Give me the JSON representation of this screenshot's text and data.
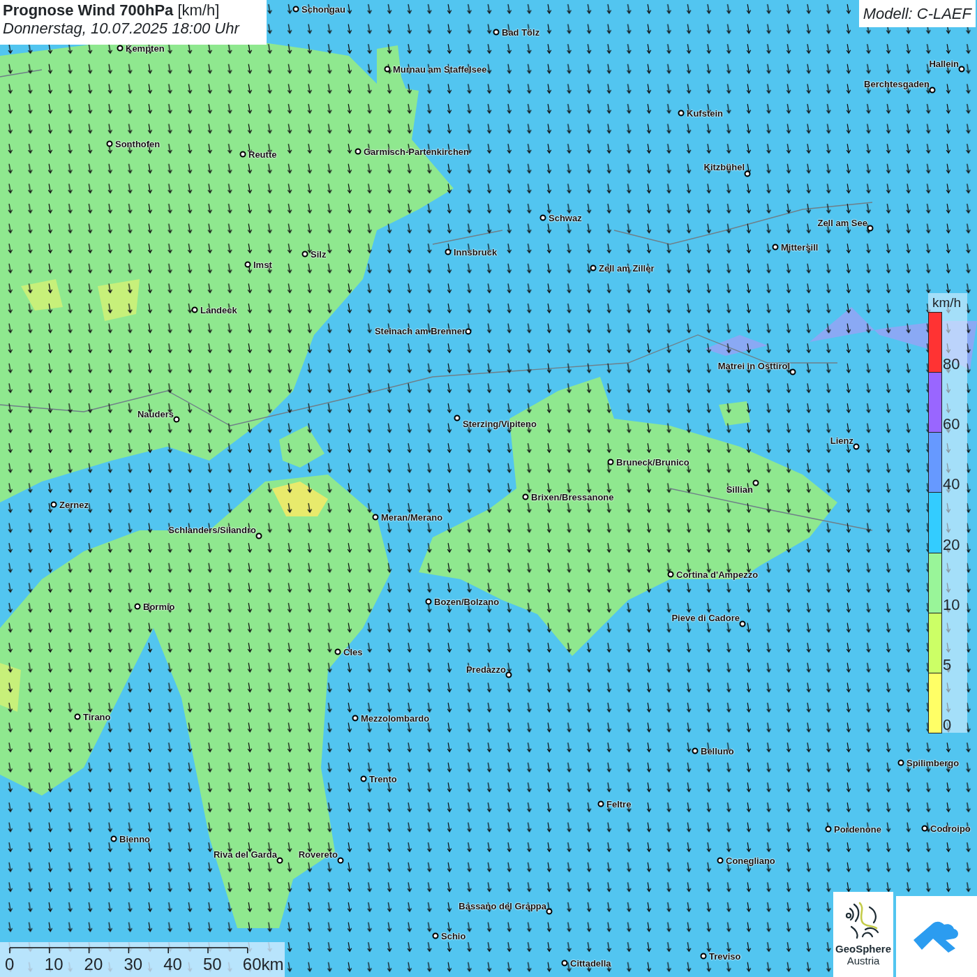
{
  "title": {
    "heading": "**Prognose Wind 700hPa** [km/h]",
    "datetime": "Donnerstag, 10.07.2025 18:00 Uhr"
  },
  "model": "Modell: C-LAEF",
  "cities": [
    {
      "name": "Schongau"
    },
    {
      "name": "Bad Tölz"
    },
    {
      "name": "Kempten"
    },
    {
      "name": "Murnau am Staffelsee"
    },
    {
      "name": "Hallein"
    },
    {
      "name": "Berchtesgaden"
    },
    {
      "name": "Kufstein"
    },
    {
      "name": "Sonthofen"
    },
    {
      "name": "Reutte"
    },
    {
      "name": "Garmisch-Partenkirchen"
    },
    {
      "name": "Kitzbühel"
    },
    {
      "name": "Schwaz"
    },
    {
      "name": "Zell am See"
    },
    {
      "name": "Innsbruck"
    },
    {
      "name": "Mittersill"
    },
    {
      "name": "Silz"
    },
    {
      "name": "Imst"
    },
    {
      "name": "Zell am Ziller"
    },
    {
      "name": "Landeck"
    },
    {
      "name": "Steinach am Brenner"
    },
    {
      "name": "Matrei in Osttirol"
    },
    {
      "name": "Nauders"
    },
    {
      "name": "Sterzing/Vipiteno"
    },
    {
      "name": "Lienz"
    },
    {
      "name": "Bruneck/Brunico"
    },
    {
      "name": "Sillian"
    },
    {
      "name": "Brixen/Bressanone"
    },
    {
      "name": "Zernez"
    },
    {
      "name": "Meran/Merano"
    },
    {
      "name": "Schlanders/Silandro"
    },
    {
      "name": "Cortina d'Ampezzo"
    },
    {
      "name": "Bozen/Bolzano"
    },
    {
      "name": "Bormio"
    },
    {
      "name": "Pieve di Cadore"
    },
    {
      "name": "Cles"
    },
    {
      "name": "Predazzo"
    },
    {
      "name": "Tirano"
    },
    {
      "name": "Mezzolombardo"
    },
    {
      "name": "Belluno"
    },
    {
      "name": "Spilimbergo"
    },
    {
      "name": "Trento"
    },
    {
      "name": "Feltre"
    },
    {
      "name": "Pordenone"
    },
    {
      "name": "Codroipo"
    },
    {
      "name": "Bienno"
    },
    {
      "name": "Riva del Garda"
    },
    {
      "name": "Rovereto"
    },
    {
      "name": "Conegliano"
    },
    {
      "name": "Bassano del Grappa"
    },
    {
      "name": "Schio"
    },
    {
      "name": "Treviso"
    },
    {
      "name": "Cittadella"
    }
  ],
  "legend": {
    "unit": "km/h",
    "items": [
      {
        "label": "80",
        "color": "#ff3333"
      },
      {
        "label": "60",
        "color": "#9966ff"
      },
      {
        "label": "40",
        "color": "#6699ff"
      },
      {
        "label": "20",
        "color": "#33ccff"
      },
      {
        "label": "10",
        "color": "#99f599"
      },
      {
        "label": "5",
        "color": "#ccff66"
      },
      {
        "label": "0",
        "color": "#ffff66"
      }
    ]
  },
  "scale": {
    "ticks": [
      "0",
      "10",
      "20",
      "30",
      "40",
      "50",
      "60km"
    ]
  },
  "logos": {
    "geosphere": {
      "line_1": "GeoSphere",
      "line_2": "Austria"
    }
  }
}
